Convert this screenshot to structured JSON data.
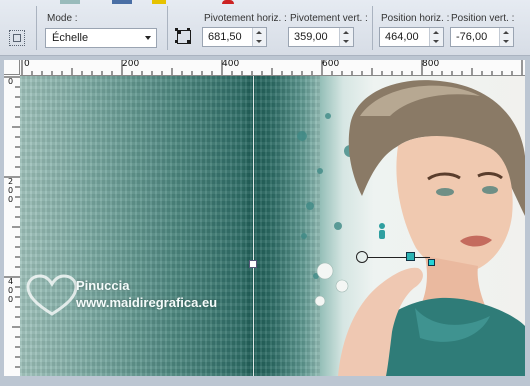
{
  "toolbar": {
    "mode": {
      "label": "Mode :",
      "value": "Échelle"
    },
    "pivot_h": {
      "label": "Pivotement horiz. :",
      "value": "681,50"
    },
    "pivot_v": {
      "label": "Pivotement vert. :",
      "value": "359,00"
    },
    "pos_h": {
      "label": "Position horiz. :",
      "value": "464,00"
    },
    "pos_v": {
      "label": "Position vert. :",
      "value": "-76,00"
    }
  },
  "ruler_top": [
    "0",
    "200",
    "400",
    "600",
    "800"
  ],
  "ruler_left": [
    "0",
    "2\n0\n0",
    "4\n0\n0"
  ],
  "watermark": {
    "name": "Pinuccia",
    "url": "www.maidiregrafica.eu"
  },
  "colors": {
    "accent_teal": "#2f6f68",
    "toolbar_bg": "#dde3eb",
    "canvas_frame": "#bcc6d2"
  }
}
